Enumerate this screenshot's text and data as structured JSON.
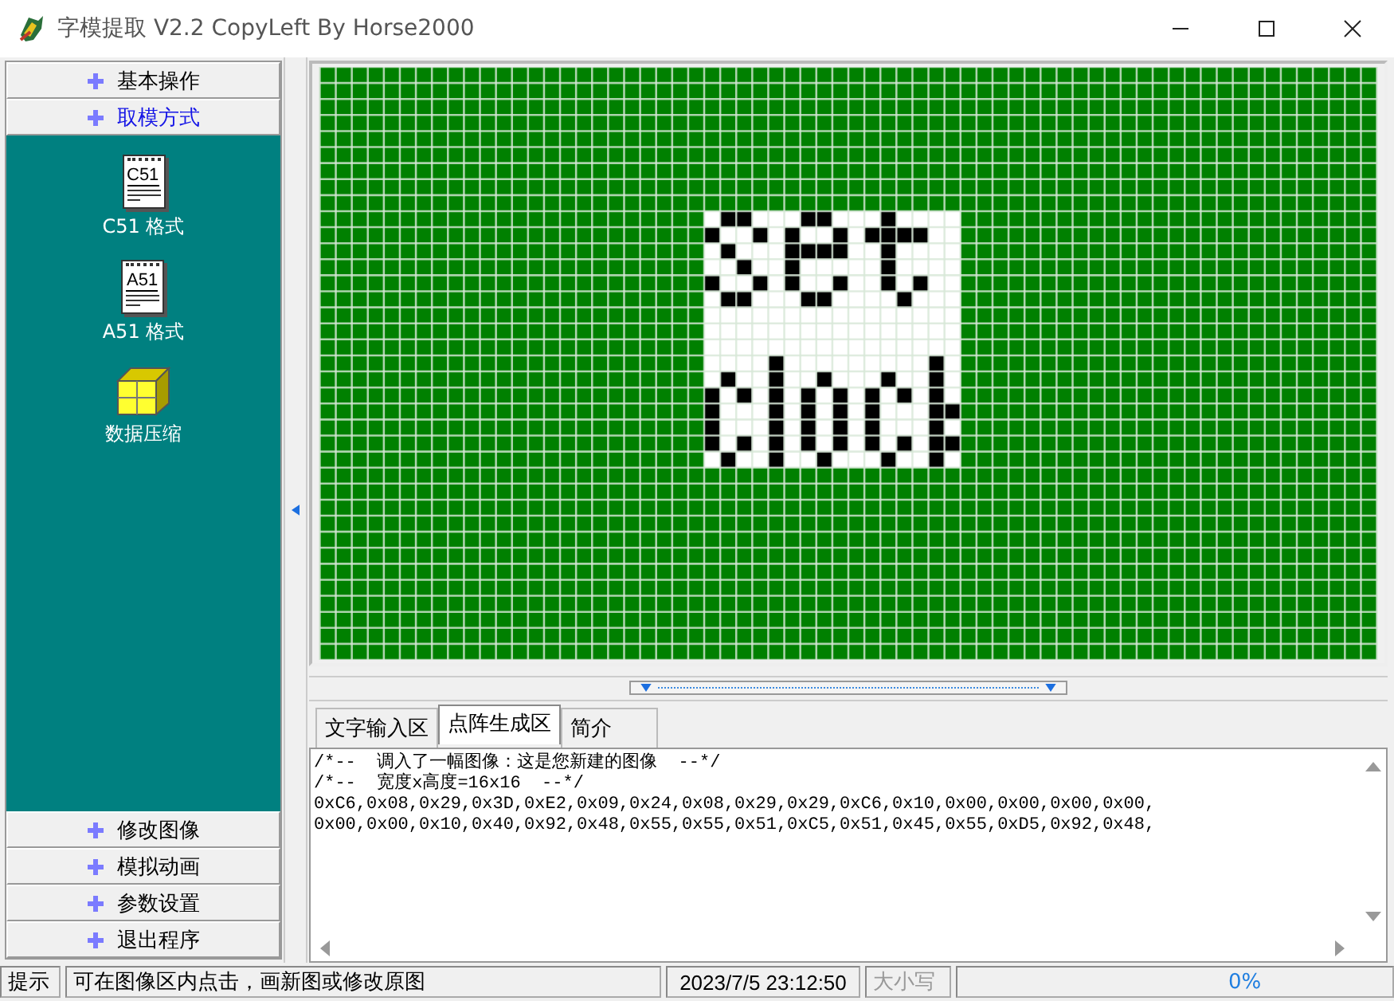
{
  "window": {
    "title": "字模提取 V2.2  CopyLeft By Horse2000"
  },
  "sidebar": {
    "groups": [
      {
        "label": "基本操作",
        "selected": false
      },
      {
        "label": "取模方式",
        "selected": true
      },
      {
        "label": "修改图像",
        "selected": false
      },
      {
        "label": "模拟动画",
        "selected": false
      },
      {
        "label": "参数设置",
        "selected": false
      },
      {
        "label": "退出程序",
        "selected": false
      }
    ],
    "items": [
      {
        "kind": "document",
        "icon_text": "C51",
        "label": "C51 格式"
      },
      {
        "kind": "document",
        "icon_text": "A51",
        "label": "A51 格式"
      },
      {
        "kind": "cube",
        "label": "数据压缩"
      }
    ]
  },
  "tabs": [
    {
      "label": "文字输入区",
      "selected": false
    },
    {
      "label": "点阵生成区",
      "selected": true
    },
    {
      "label": "简介",
      "selected": false
    }
  ],
  "output": {
    "lines": [
      "/*--  调入了一幅图像：这是您新建的图像  --*/",
      "/*--  宽度x高度=16x16  --*/",
      "0xC6,0x08,0x29,0x3D,0xE2,0x09,0x24,0x08,0x29,0x29,0xC6,0x10,0x00,0x00,0x00,0x00,",
      "0x00,0x00,0x10,0x40,0x92,0x48,0x55,0x55,0x51,0xC5,0x51,0x45,0x55,0xD5,0x92,0x48,"
    ]
  },
  "status_bar": {
    "label": "提示",
    "message": "可在图像区内点击，画新图或修改原图",
    "datetime": "2023/7/5 23:12:50",
    "caps": {
      "label": "大小写",
      "on": false
    },
    "progress": "0%"
  }
}
